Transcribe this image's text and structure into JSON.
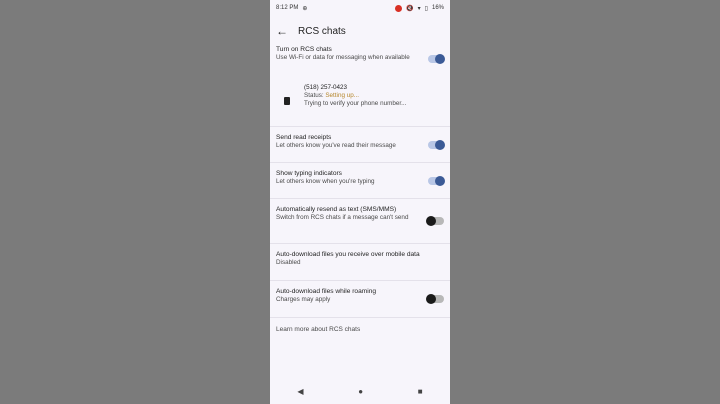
{
  "status_bar": {
    "time": "8:12 PM",
    "battery": "16%"
  },
  "app_bar": {
    "title": "RCS chats"
  },
  "rcs": {
    "title": "Turn on RCS chats",
    "subtitle": "Use Wi-Fi or data for messaging when available",
    "enabled": true
  },
  "number": {
    "value": "(518) 257-0423",
    "status_label": "Status:",
    "status_value": "Setting up...",
    "note": "Trying to verify your phone number..."
  },
  "read_receipts": {
    "title": "Send read receipts",
    "subtitle": "Let others know you've read their message",
    "enabled": true
  },
  "typing": {
    "title": "Show typing indicators",
    "subtitle": "Let others know when you're typing",
    "enabled": true
  },
  "resend": {
    "title": "Automatically resend as text (SMS/MMS)",
    "subtitle": "Switch from RCS chats if a message can't send",
    "enabled": false
  },
  "auto_download_mobile": {
    "title": "Auto-download files you receive over mobile data",
    "subtitle": "Disabled"
  },
  "auto_download_roaming": {
    "title": "Auto-download files while roaming",
    "subtitle": "Charges may apply",
    "enabled": false
  },
  "learn_more": {
    "prefix": "Learn more",
    "rest": "about RCS chats"
  },
  "nav": {
    "back": "◀",
    "home": "●",
    "recents": "■"
  }
}
